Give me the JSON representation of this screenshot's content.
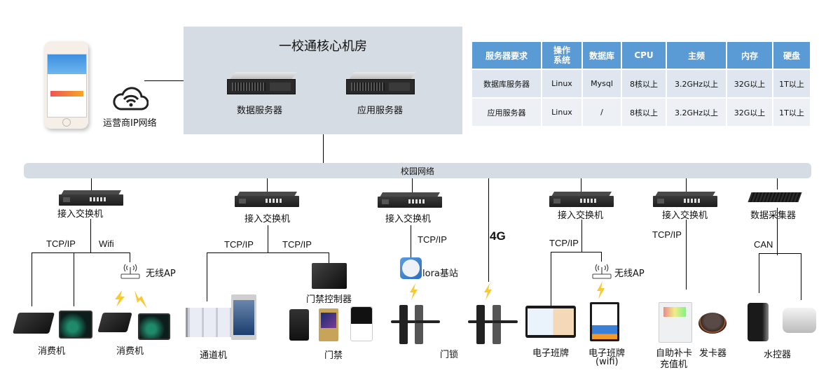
{
  "mobile": {
    "network_label": "运营商IP网络",
    "icon": "cloud-wifi-icon"
  },
  "core_room": {
    "title": "一校通核心机房",
    "servers": [
      {
        "label": "数据服务器",
        "icon": "rack-server-icon"
      },
      {
        "label": "应用服务器",
        "icon": "rack-server-icon"
      }
    ]
  },
  "spec_table": {
    "headers": [
      "服务器要求",
      "操作系统",
      "数据库",
      "CPU",
      "主频",
      "内存",
      "硬盘"
    ],
    "header_os_line1": "操作",
    "header_os_line2": "系统",
    "rows": [
      [
        "数据库服务器",
        "Linux",
        "Mysql",
        "8核以上",
        "3.2GHz以上",
        "32G以上",
        "1T以上"
      ],
      [
        "应用服务器",
        "Linux",
        "/",
        "8核以上",
        "3.2GHz以上",
        "32G以上",
        "1T以上"
      ]
    ],
    "header_color": "#5b9bd5"
  },
  "campus_network": {
    "label": "校园网络"
  },
  "branches": {
    "b1": {
      "switch_label": "接入交换机",
      "proto_left": "TCP/IP",
      "proto_right": "Wifi",
      "ap_label": "无线AP",
      "device_left": "消费机",
      "device_right": "消费机"
    },
    "b2": {
      "switch_label": "接入交换机",
      "proto_left": "TCP/IP",
      "proto_right": "TCP/IP",
      "controller_label": "门禁控制器",
      "device_left": "通道机",
      "device_right": "门禁"
    },
    "b3": {
      "switch_label": "接入交换机",
      "proto": "TCP/IP",
      "base_station_label": "lora基站",
      "cellular_label": "4G",
      "device": "门锁"
    },
    "b4": {
      "switch_label": "接入交换机",
      "proto": "TCP/IP",
      "ap_label": "无线AP",
      "device_left": "电子班牌",
      "device_right_line1": "电子班牌",
      "device_right_line2": "(wifi)"
    },
    "b5": {
      "switch_label": "接入交换机",
      "proto": "TCP/IP",
      "device_left_line1": "自助补卡",
      "device_left_line2": "充值机",
      "device_right": "发卡器"
    },
    "b6": {
      "collector_label": "数据采集器",
      "proto": "CAN",
      "device": "水控器"
    }
  },
  "colors": {
    "panel_bg": "#d6dce4",
    "bolt": "#f7c933",
    "line": "#000000"
  }
}
